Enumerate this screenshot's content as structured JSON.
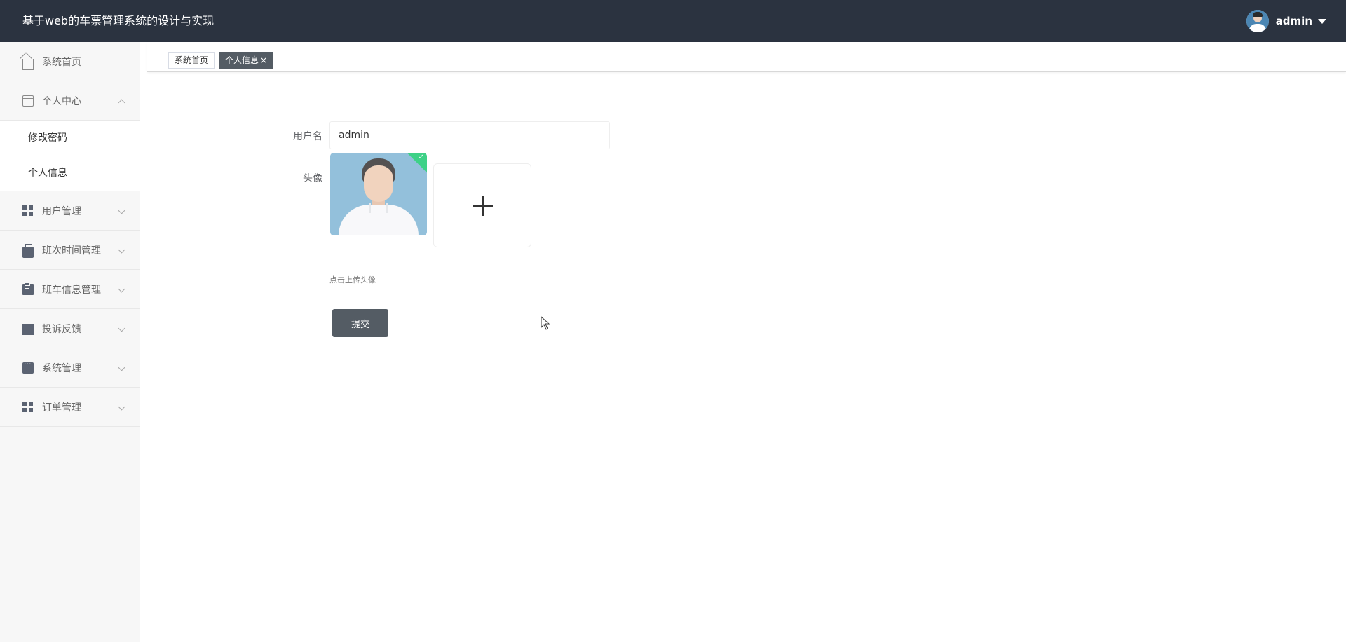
{
  "header": {
    "title": "基于web的车票管理系统的设计与实现",
    "user": "admin"
  },
  "sidebar": {
    "items": [
      {
        "label": "系统首页",
        "icon": "home-icon"
      },
      {
        "label": "个人中心",
        "icon": "card-icon",
        "expanded": true,
        "children": [
          {
            "label": "修改密码"
          },
          {
            "label": "个人信息"
          }
        ]
      },
      {
        "label": "用户管理",
        "icon": "grid-icon"
      },
      {
        "label": "班次时间管理",
        "icon": "briefcase-icon"
      },
      {
        "label": "班车信息管理",
        "icon": "clipboard-icon"
      },
      {
        "label": "投诉反馈",
        "icon": "monitor-icon"
      },
      {
        "label": "系统管理",
        "icon": "chat-icon"
      },
      {
        "label": "订单管理",
        "icon": "grid-icon"
      }
    ]
  },
  "tabs": [
    {
      "label": "系统首页",
      "active": false
    },
    {
      "label": "个人信息",
      "active": true,
      "close": "×"
    }
  ],
  "form": {
    "username_label": "用户名",
    "username_value": "admin",
    "avatar_label": "头像",
    "upload_plus": "+",
    "upload_tip": "点击上传头像",
    "submit_label": "提交"
  },
  "colors": {
    "header_bg": "#2b3340",
    "sidebar_bg": "#f7f7f7",
    "active_tab_bg": "#545c64",
    "button_bg": "#545c64",
    "success_badge": "#13ce66"
  }
}
